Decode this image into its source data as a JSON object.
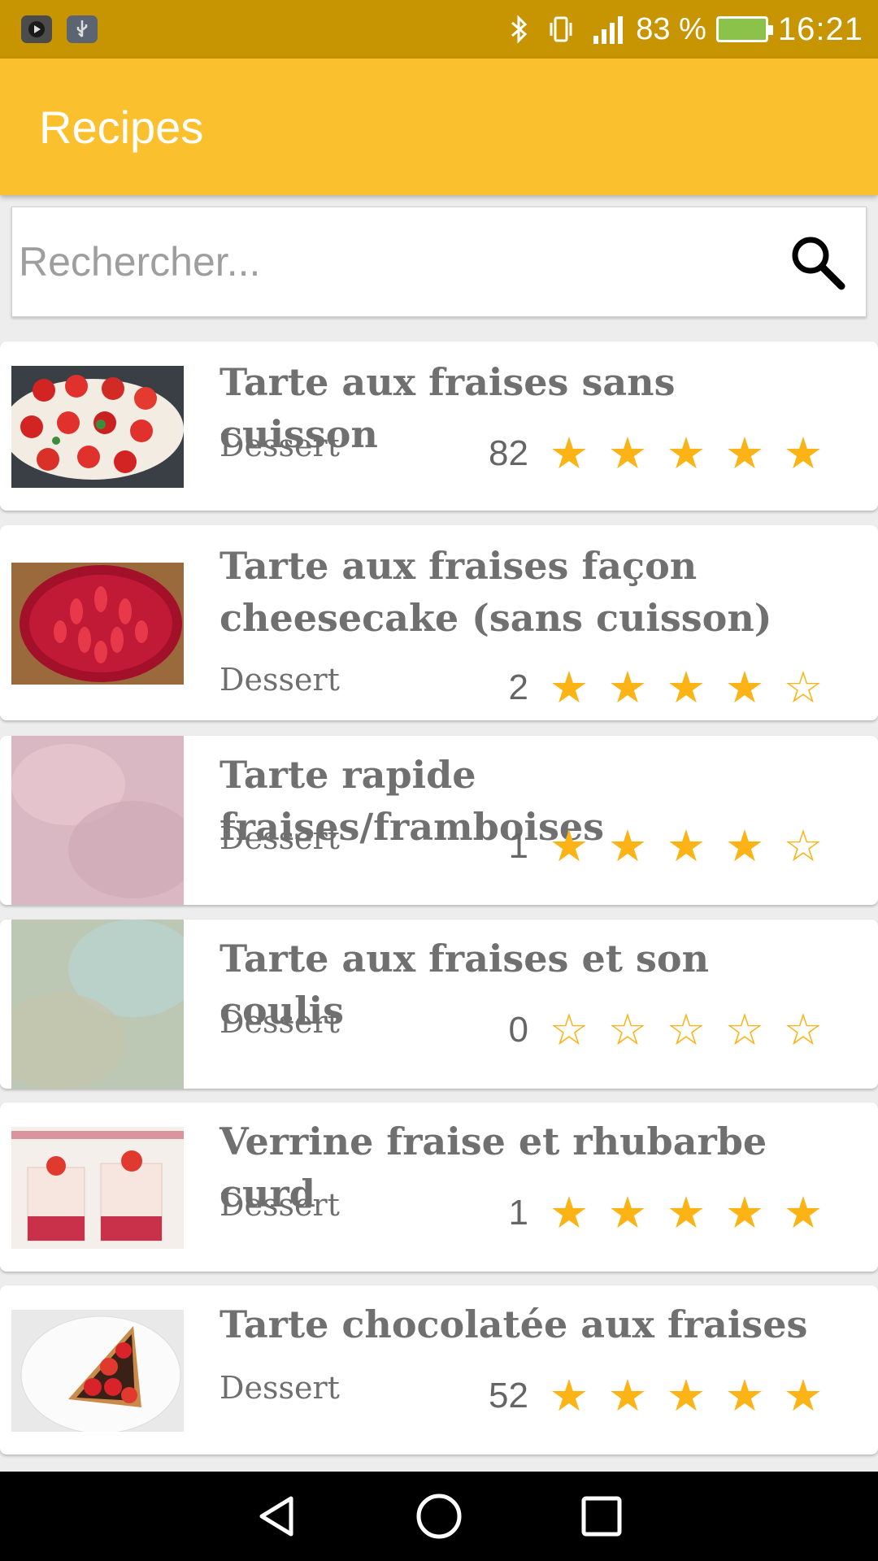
{
  "status_bar": {
    "battery_text": "83 %",
    "time": "16:21",
    "network": "4G"
  },
  "app_bar": {
    "title": "Recipes"
  },
  "search": {
    "placeholder": "Rechercher...",
    "value": ""
  },
  "recipes": [
    {
      "title": "Tarte aux fraises sans cuisson",
      "category": "Dessert",
      "count": "82",
      "rating": 5,
      "image": "strawberry-cheesecake-photo"
    },
    {
      "title": "Tarte aux fraises façon cheesecake (sans cuisson)",
      "category": "Dessert",
      "count": "2",
      "rating": 4,
      "image": "strawberry-jelly-tart-photo"
    },
    {
      "title": "Tarte rapide fraises/framboises",
      "category": "Dessert",
      "count": "1",
      "rating": 4,
      "image": "loading-placeholder-pink"
    },
    {
      "title": "Tarte aux fraises et son coulis",
      "category": "Dessert",
      "count": "0",
      "rating": 0,
      "image": "loading-placeholder-green"
    },
    {
      "title": "Verrine fraise et rhubarbe curd",
      "category": "Dessert",
      "count": "1",
      "rating": 5,
      "image": "strawberry-verrine-photo"
    },
    {
      "title": "Tarte chocolatée aux fraises",
      "category": "Dessert",
      "count": "52",
      "rating": 5,
      "image": "chocolate-strawberry-tart-photo"
    }
  ],
  "colors": {
    "status_bar": "#c79402",
    "app_bar": "#fbc02d",
    "star": "#fbb315"
  }
}
